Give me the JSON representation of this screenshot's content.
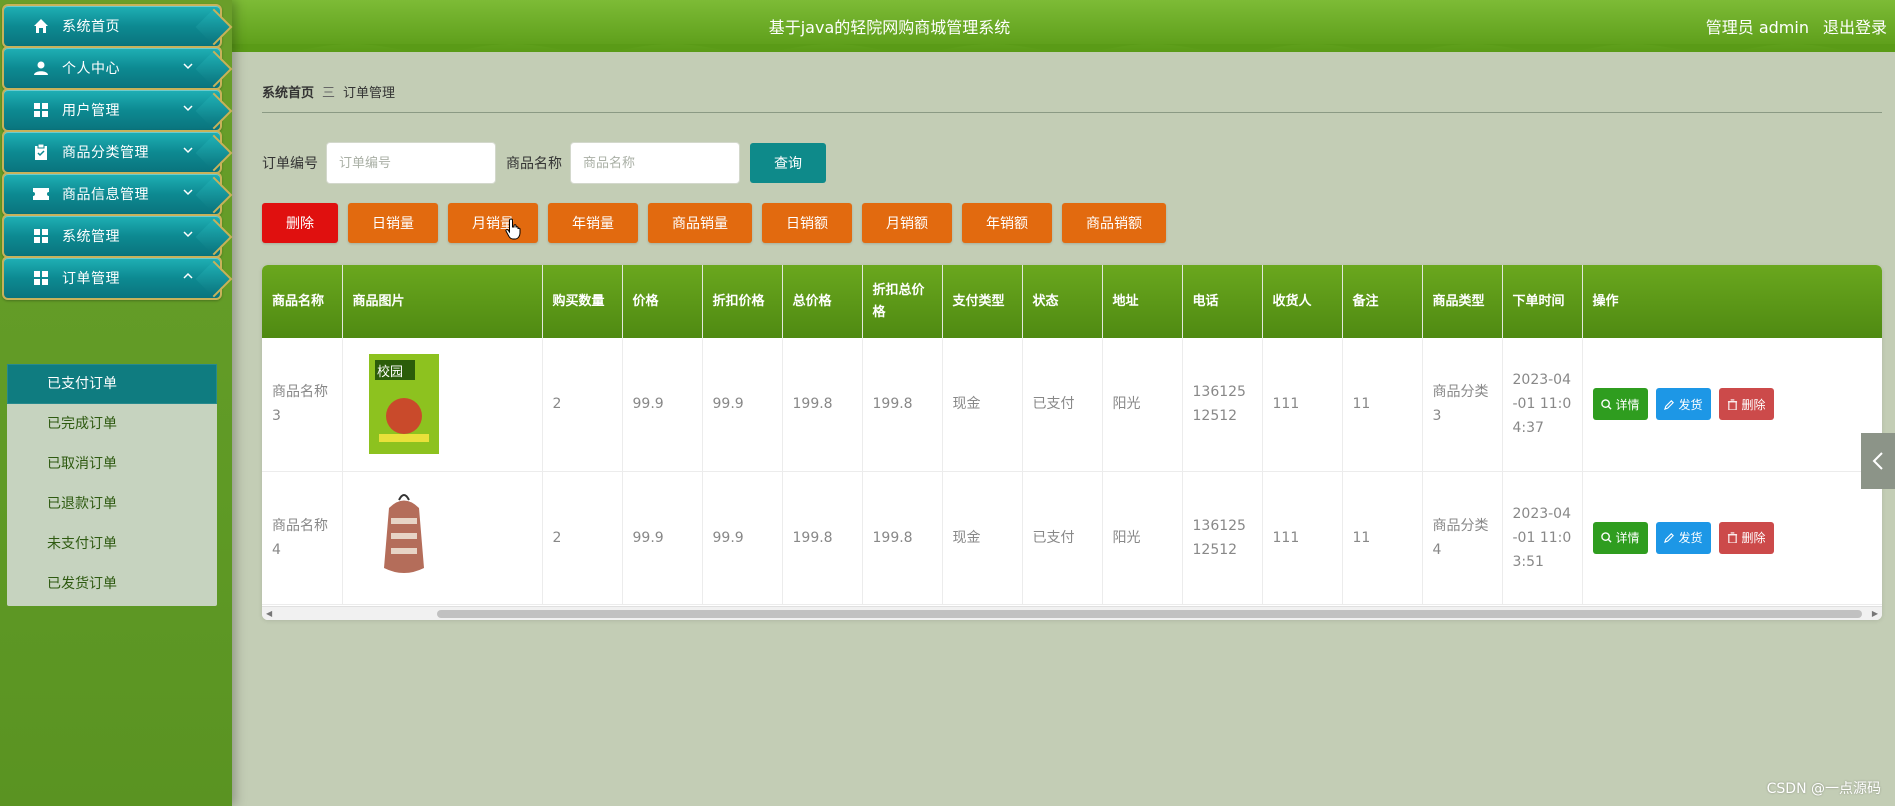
{
  "header": {
    "title": "基于java的轻院网购商城管理系统",
    "admin_label": "管理员 admin",
    "logout_label": "退出登录"
  },
  "sidebar": {
    "items": [
      {
        "label": "系统首页",
        "icon": "home-icon"
      },
      {
        "label": "个人中心",
        "icon": "user-icon"
      },
      {
        "label": "用户管理",
        "icon": "grid-icon"
      },
      {
        "label": "商品分类管理",
        "icon": "clipboard-icon"
      },
      {
        "label": "商品信息管理",
        "icon": "ticket-icon"
      },
      {
        "label": "系统管理",
        "icon": "grid-icon"
      },
      {
        "label": "订单管理",
        "icon": "grid-icon"
      }
    ],
    "submenu": [
      "已支付订单",
      "已完成订单",
      "已取消订单",
      "已退款订单",
      "未支付订单",
      "已发货订单"
    ]
  },
  "breadcrumb": {
    "home": "系统首页",
    "separator": "三",
    "current": "订单管理"
  },
  "search": {
    "order_no_label": "订单编号",
    "order_no_placeholder": "订单编号",
    "product_name_label": "商品名称",
    "product_name_placeholder": "商品名称",
    "query_label": "查询"
  },
  "actions": {
    "delete": "删除",
    "buttons": [
      "日销量",
      "月销量",
      "年销量",
      "商品销量",
      "日销额",
      "月销额",
      "年销额",
      "商品销额"
    ]
  },
  "table": {
    "columns": [
      "商品名称",
      "商品图片",
      "购买数量",
      "价格",
      "折扣价格",
      "总价格",
      "折扣总价格",
      "支付类型",
      "状态",
      "地址",
      "电话",
      "收货人",
      "备注",
      "商品类型",
      "下单时间",
      "操作"
    ],
    "rows": [
      {
        "name": "商品名称3",
        "qty": "2",
        "price": "99.9",
        "discount_price": "99.9",
        "total": "199.8",
        "discount_total": "199.8",
        "pay_type": "现金",
        "status": "已支付",
        "address": "阳光",
        "phone": "13612512512",
        "receiver": "111",
        "remark": "11",
        "category": "商品分类3",
        "time": "2023-04-01 11:04:37",
        "image_text": "校园"
      },
      {
        "name": "商品名称4",
        "qty": "2",
        "price": "99.9",
        "discount_price": "99.9",
        "total": "199.8",
        "discount_total": "199.8",
        "pay_type": "现金",
        "status": "已支付",
        "address": "阳光",
        "phone": "13612512512",
        "receiver": "111",
        "remark": "11",
        "category": "商品分类4",
        "time": "2023-04-01 11:03:51",
        "image_text": ""
      }
    ],
    "op_labels": {
      "detail": "详情",
      "ship": "发货",
      "remove": "删除"
    }
  },
  "watermark": "CSDN @一点源码",
  "colors": {
    "header": "#5a9b17",
    "menu": "#0d8a92",
    "query": "#0e8a8a",
    "orange": "#e26a0f",
    "red": "#e0100f",
    "detail": "#2f9d1f",
    "ship": "#1d97e6",
    "remove": "#cc4a4a"
  }
}
